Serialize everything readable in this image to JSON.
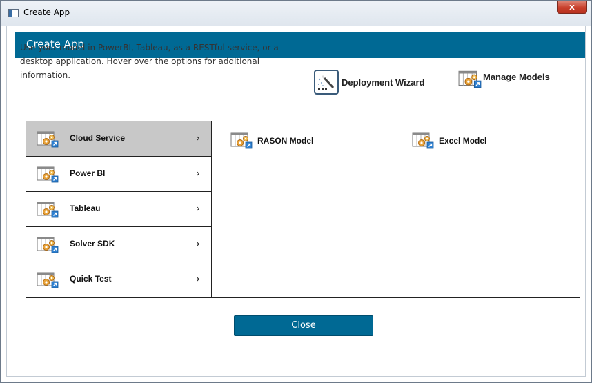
{
  "window": {
    "title": "Create App",
    "close_glyph": "x"
  },
  "header": {
    "title": "Create App"
  },
  "description": "Use your model in PowerBI, Tableau, as a RESTful service, or a desktop application. Hover over the options for additional information.",
  "actions": {
    "deployment_wizard": "Deployment Wizard",
    "manage_models": "Manage Models"
  },
  "sidebar": {
    "items": [
      {
        "label": "Cloud Service",
        "selected": true
      },
      {
        "label": "Power BI"
      },
      {
        "label": "Tableau"
      },
      {
        "label": "Solver SDK"
      },
      {
        "label": "Quick Test"
      }
    ],
    "chevron": "›"
  },
  "models": [
    {
      "label": "RASON Model"
    },
    {
      "label": "Excel Model"
    }
  ],
  "footer": {
    "close_label": "Close"
  },
  "colors": {
    "accent": "#006994",
    "selected_row": "#c8c8c8",
    "gear": "#e8a33a",
    "link_badge": "#2d7fd0"
  },
  "icons": {
    "model": "model-gear-icon",
    "wizard": "wand-icon",
    "chevron": "chevron-right-icon"
  }
}
